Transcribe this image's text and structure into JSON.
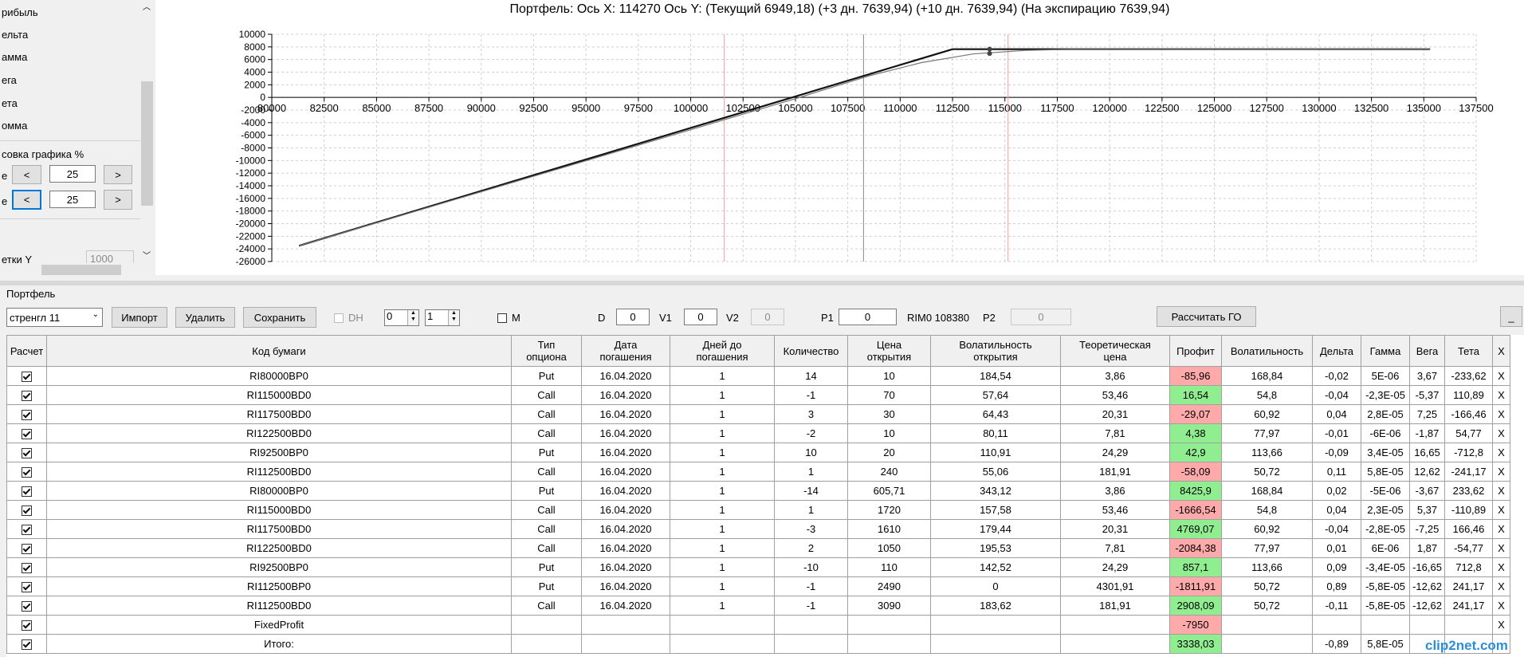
{
  "left_panel": {
    "items": [
      "рибыль",
      "ельта",
      "амма",
      "ега",
      "ета",
      "омма"
    ],
    "scale_label": "совка графика %",
    "row1_prefix": "е",
    "row2_prefix": "е",
    "dec_label": "<",
    "inc_label": ">",
    "row1_value": "25",
    "row2_value": "25",
    "grid_y_label": "етки Y",
    "grid_y_value": "1000"
  },
  "chart": {
    "title": "Портфель: Ось X: 114270 Ось Y:  (Текущий 6949,18)  (+3 дн. 7639,94)  (+10 дн. 7639,94)  (На экспирацию 7639,94)",
    "x_ticks": [
      "80000",
      "82500",
      "85000",
      "87500",
      "90000",
      "92500",
      "95000",
      "97500",
      "100000",
      "102500",
      "105000",
      "107500",
      "110000",
      "112500",
      "115000",
      "117500",
      "120000",
      "122500",
      "125000",
      "127500",
      "130000",
      "132500",
      "135000",
      "137500"
    ],
    "y_ticks": [
      "10000",
      "8000",
      "6000",
      "4000",
      "2000",
      "0",
      "-2000",
      "-4000",
      "-6000",
      "-8000",
      "-10000",
      "-12000",
      "-14000",
      "-16000",
      "-18000",
      "-20000",
      "-22000",
      "-24000",
      "-26000"
    ]
  },
  "chart_data": {
    "type": "line",
    "title": "Портфель: Ось X: 114270 Ось Y:  (Текущий 6949,18)  (+3 дн. 7639,94)  (+10 дн. 7639,94)  (На экспирацию 7639,94)",
    "xlim": [
      80000,
      137500
    ],
    "ylim": [
      -26000,
      10000
    ],
    "series": [
      {
        "x": [
          81300,
          112500,
          135300
        ],
        "y": [
          -23500,
          7640,
          7640
        ],
        "color": "#111111"
      },
      {
        "x": [
          81300,
          105000,
          108500,
          111000,
          113500,
          116000,
          118000,
          135300
        ],
        "y": [
          -23500,
          -200,
          3400,
          5500,
          6900,
          7450,
          7600,
          7640
        ],
        "color": "#777777"
      }
    ],
    "markers": [
      {
        "x": 114270,
        "y": 7640
      },
      {
        "x": 114270,
        "y": 6949
      }
    ],
    "vlines": [
      {
        "x": 101600,
        "color": "#f4a0a8"
      },
      {
        "x": 108250,
        "color": "#888888"
      },
      {
        "x": 115150,
        "color": "#f4a0a8"
      }
    ],
    "grid": true
  },
  "toolbar": {
    "section_label": "Портфель",
    "portfolio_select": "стренгл 11",
    "import_label": "Импорт",
    "delete_label": "Удалить",
    "save_label": "Сохранить",
    "dh_label": "DH",
    "spin1_value": "0",
    "spin2_value": "1",
    "m_label": "M",
    "d_label": "D",
    "d_value": "0",
    "v1_label": "V1",
    "v1_value": "0",
    "v2_label": "V2",
    "v2_value": "0",
    "p1_label": "P1",
    "p1_value": "0",
    "rim_label": "RIM0 108380",
    "p2_label": "P2",
    "p2_value": "0",
    "calc_go_label": "Рассчитать ГО",
    "minimize_label": "_"
  },
  "table": {
    "headers": [
      "Расчет",
      "Код бумаги",
      "Тип\nопциона",
      "Дата\nпогашения",
      "Дней до\nпогашения",
      "Количество",
      "Цена\nоткрытия",
      "Волатильность\nоткрытия",
      "Теоретическая\nцена",
      "Профит",
      "Волатильность",
      "Дельта",
      "Гамма",
      "Вега",
      "Тета",
      "X"
    ],
    "rows": [
      [
        "RI80000BP0",
        "Put",
        "16.04.2020",
        "1",
        "14",
        "10",
        "184,54",
        "3,86",
        "-85,96",
        "168,84",
        "-0,02",
        "5E-06",
        "3,67",
        "-233,62",
        "X"
      ],
      [
        "RI115000BD0",
        "Call",
        "16.04.2020",
        "1",
        "-1",
        "70",
        "57,64",
        "53,46",
        "16,54",
        "54,8",
        "-0,04",
        "-2,3E-05",
        "-5,37",
        "110,89",
        "X"
      ],
      [
        "RI117500BD0",
        "Call",
        "16.04.2020",
        "1",
        "3",
        "30",
        "64,43",
        "20,31",
        "-29,07",
        "60,92",
        "0,04",
        "2,8E-05",
        "7,25",
        "-166,46",
        "X"
      ],
      [
        "RI122500BD0",
        "Call",
        "16.04.2020",
        "1",
        "-2",
        "10",
        "80,11",
        "7,81",
        "4,38",
        "77,97",
        "-0,01",
        "-6E-06",
        "-1,87",
        "54,77",
        "X"
      ],
      [
        "RI92500BP0",
        "Put",
        "16.04.2020",
        "1",
        "10",
        "20",
        "110,91",
        "24,29",
        "42,9",
        "113,66",
        "-0,09",
        "3,4E-05",
        "16,65",
        "-712,8",
        "X"
      ],
      [
        "RI112500BD0",
        "Call",
        "16.04.2020",
        "1",
        "1",
        "240",
        "55,06",
        "181,91",
        "-58,09",
        "50,72",
        "0,11",
        "5,8E-05",
        "12,62",
        "-241,17",
        "X"
      ],
      [
        "RI80000BP0",
        "Put",
        "16.04.2020",
        "1",
        "-14",
        "605,71",
        "343,12",
        "3,86",
        "8425,9",
        "168,84",
        "0,02",
        "-5E-06",
        "-3,67",
        "233,62",
        "X"
      ],
      [
        "RI115000BD0",
        "Call",
        "16.04.2020",
        "1",
        "1",
        "1720",
        "157,58",
        "53,46",
        "-1666,54",
        "54,8",
        "0,04",
        "2,3E-05",
        "5,37",
        "-110,89",
        "X"
      ],
      [
        "RI117500BD0",
        "Call",
        "16.04.2020",
        "1",
        "-3",
        "1610",
        "179,44",
        "20,31",
        "4769,07",
        "60,92",
        "-0,04",
        "-2,8E-05",
        "-7,25",
        "166,46",
        "X"
      ],
      [
        "RI122500BD0",
        "Call",
        "16.04.2020",
        "1",
        "2",
        "1050",
        "195,53",
        "7,81",
        "-2084,38",
        "77,97",
        "0,01",
        "6E-06",
        "1,87",
        "-54,77",
        "X"
      ],
      [
        "RI92500BP0",
        "Put",
        "16.04.2020",
        "1",
        "-10",
        "110",
        "142,52",
        "24,29",
        "857,1",
        "113,66",
        "0,09",
        "-3,4E-05",
        "-16,65",
        "712,8",
        "X"
      ],
      [
        "RI112500BP0",
        "Put",
        "16.04.2020",
        "1",
        "-1",
        "2490",
        "0",
        "4301,91",
        "-1811,91",
        "50,72",
        "0,89",
        "-5,8E-05",
        "-12,62",
        "241,17",
        "X"
      ],
      [
        "RI112500BD0",
        "Call",
        "16.04.2020",
        "1",
        "-1",
        "3090",
        "183,62",
        "181,91",
        "2908,09",
        "50,72",
        "-0,11",
        "-5,8E-05",
        "-12,62",
        "241,17",
        "X"
      ],
      [
        "FixedProfit",
        "",
        "",
        "",
        "",
        "",
        "",
        "",
        "-7950",
        "",
        "",
        "",
        "",
        "",
        "X"
      ],
      [
        "Итого:",
        "",
        "",
        "",
        "",
        "",
        "",
        "",
        "3338,03",
        "",
        "-0,89",
        "5,8E-05",
        "",
        "",
        ""
      ]
    ]
  },
  "watermark": "clip2net.com"
}
